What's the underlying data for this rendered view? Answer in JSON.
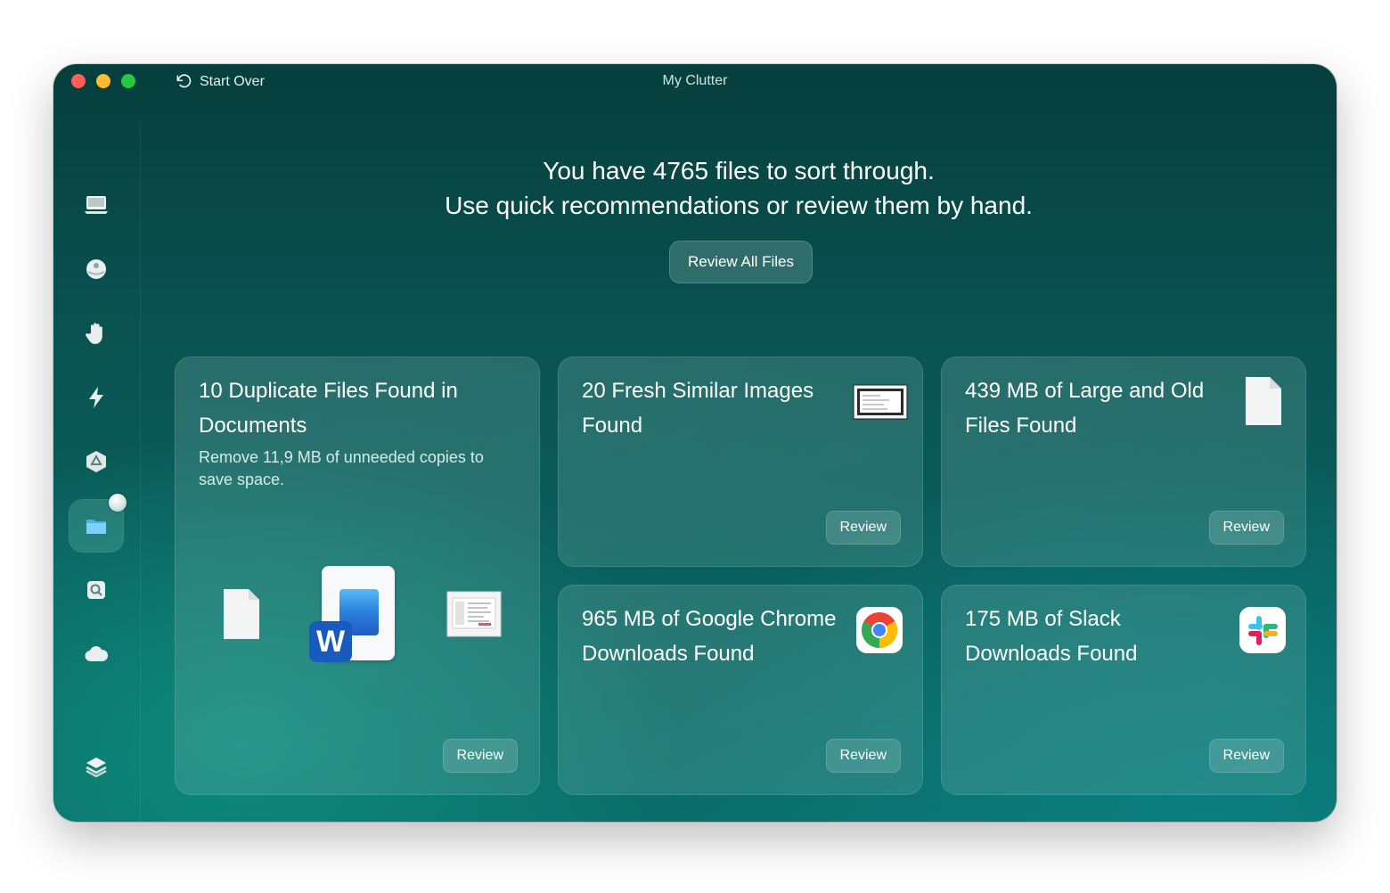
{
  "window": {
    "title": "My Clutter",
    "start_over_label": "Start Over"
  },
  "sidebar": {
    "items": [
      {
        "name": "computer-icon"
      },
      {
        "name": "ball-icon"
      },
      {
        "name": "hand-icon"
      },
      {
        "name": "bolt-icon"
      },
      {
        "name": "app-store-icon"
      },
      {
        "name": "folder-icon",
        "active": true
      },
      {
        "name": "search-disk-icon"
      },
      {
        "name": "cloud-icon"
      },
      {
        "name": "layers-icon"
      },
      {
        "name": "chart-icon"
      }
    ]
  },
  "main": {
    "headline_line1": "You have 4765 files to sort through.",
    "headline_line2": "Use quick recommendations or review them by hand.",
    "review_all_label": "Review All Files"
  },
  "cards": {
    "duplicates": {
      "title": "10 Duplicate Files Found in Documents",
      "subtitle": "Remove 11,9 MB of unneeded copies to save space.",
      "button": "Review"
    },
    "similar_images": {
      "title": "20 Fresh Similar Images Found",
      "button": "Review"
    },
    "large_old": {
      "title": "439 MB of Large and Old Files Found",
      "button": "Review"
    },
    "chrome": {
      "title": "965 MB of Google Chrome Downloads Found",
      "button": "Review"
    },
    "slack": {
      "title": "175 MB of Slack Downloads Found",
      "button": "Review"
    }
  },
  "colors": {
    "accent": "#0b6d69",
    "word_blue": "#185abd"
  }
}
